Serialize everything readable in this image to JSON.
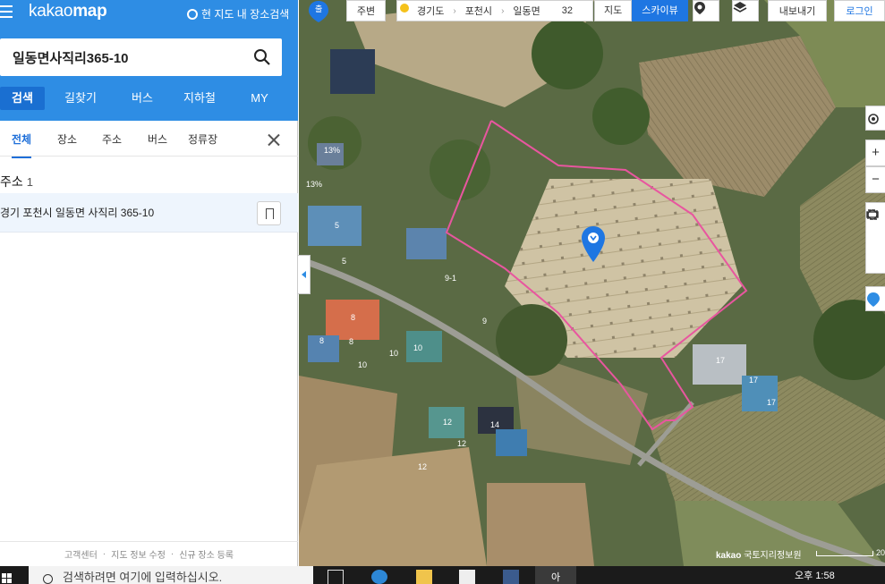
{
  "header": {
    "logo_kakao": "kakao",
    "logo_map": "map",
    "map_search_toggle": "현 지도 내 장소검색"
  },
  "search": {
    "value": "일동면사직리365-10",
    "placeholder": ""
  },
  "nav_tabs": [
    "검색",
    "길찾기",
    "버스",
    "지하철",
    "MY"
  ],
  "sub_tabs": [
    "전체",
    "장소",
    "주소",
    "버스",
    "정류장"
  ],
  "results": {
    "section_label": "주소",
    "count": "1",
    "items": [
      {
        "address": "경기 포천시 일동면 사직리 365-10"
      }
    ]
  },
  "footer_links": [
    "고객센터",
    "지도 정보 수정",
    "신규 장소 등록"
  ],
  "footer_sep": "·",
  "map_toolbar": {
    "start_label": "출",
    "nearby": "주변",
    "breadcrumb": [
      "경기도",
      "포천시",
      "일동면"
    ],
    "weather_temp": "32",
    "mode_map": "지도",
    "mode_skyview": "스카이뷰",
    "export": "내보내기",
    "login": "로그인"
  },
  "map_side_controls": [
    "location-target-icon",
    "zoom-in-icon",
    "zoom-out-icon",
    "ruler-icon",
    "area-icon",
    "radius-icon",
    "roadview-icon"
  ],
  "map_side_labels": {
    "zoom_in": "+",
    "zoom_out": "−"
  },
  "map_labels": {
    "building_numbers": [
      "13%",
      "13%",
      "5",
      "5",
      "9-1",
      "9",
      "8",
      "8",
      "8",
      "10",
      "10",
      "10",
      "12",
      "12",
      "12",
      "14",
      "17",
      "17",
      "17"
    ]
  },
  "copyright": {
    "brand": "kakao",
    "source": "국토지리정보원"
  },
  "scale_label": "20",
  "taskbar": {
    "search_placeholder": "검색하려면 여기에 입력하십시오.",
    "time_ampm": "오후",
    "time": "1:58",
    "app_tile_label": "아"
  },
  "colors": {
    "brand_blue": "#2e8de4",
    "boundary_pink": "#e8569f",
    "marker_blue": "#1e76e2"
  }
}
